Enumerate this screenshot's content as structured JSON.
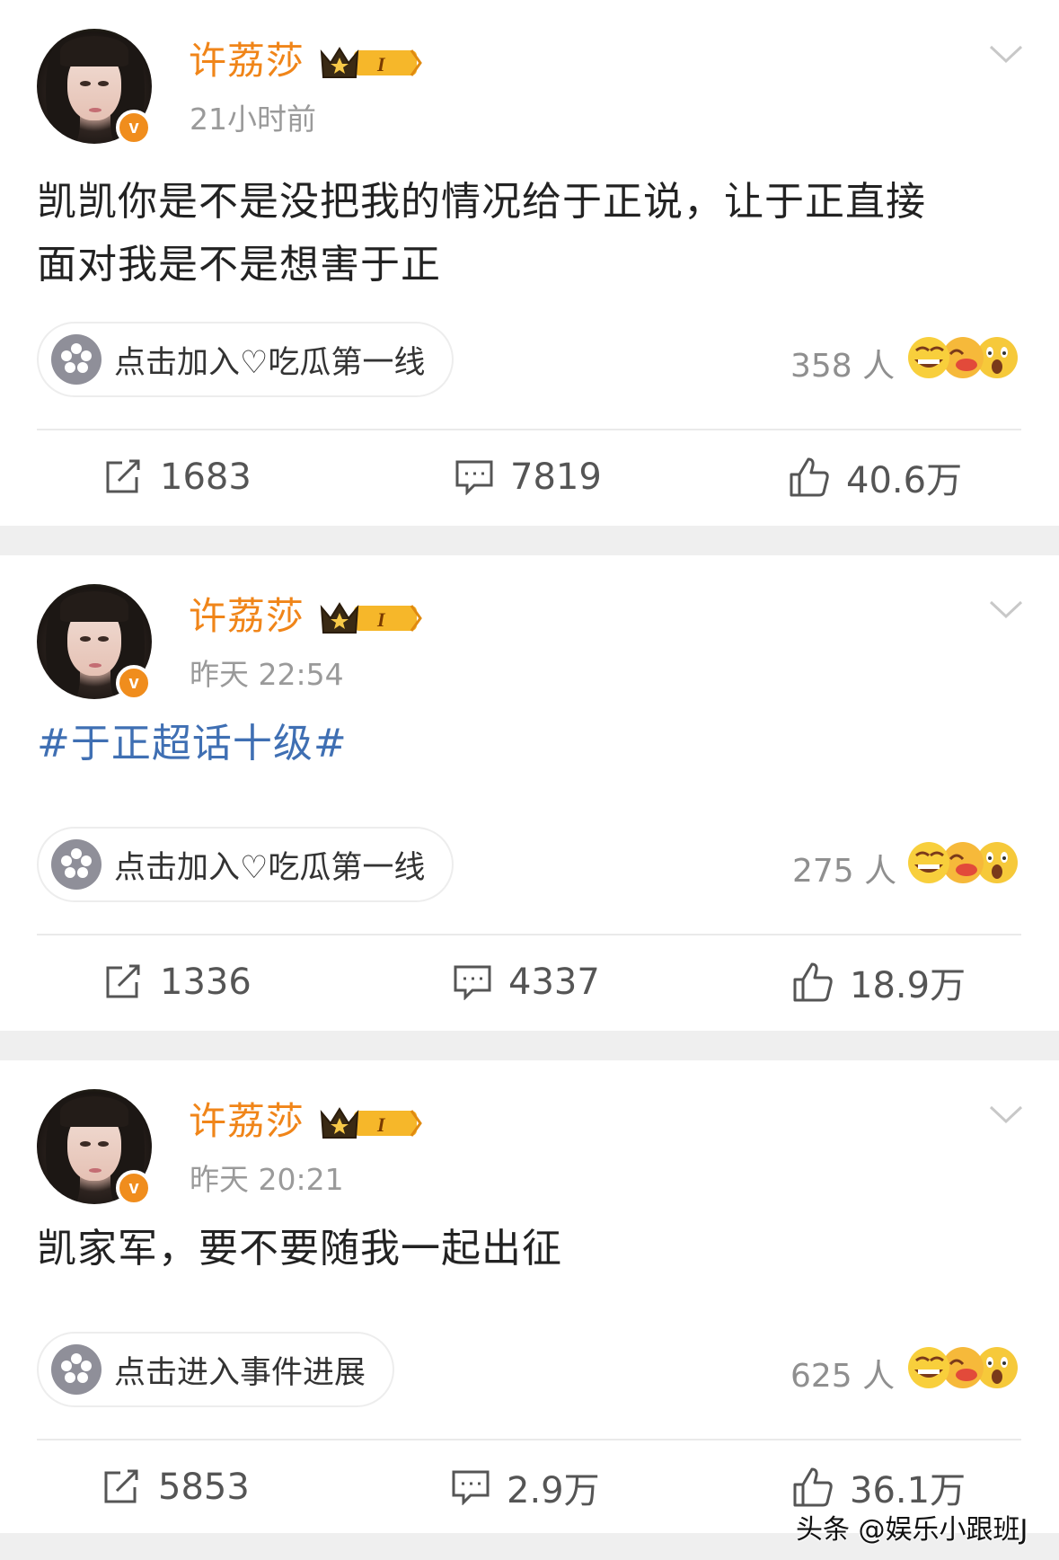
{
  "posts": [
    {
      "username": "许荔莎",
      "time": "21小时前",
      "text_lines": [
        "凯凯你是不是没把我的情况给于正说，让于正直接",
        "面对我是不是想害于正"
      ],
      "topic": false,
      "pill_label": "点击加入♡吃瓜第一线",
      "reaction_count": "358 人",
      "repost": "1683",
      "comment": "7819",
      "like": "40.6万"
    },
    {
      "username": "许荔莎",
      "time": "昨天 22:54",
      "text_lines": [
        "#于正超话十级#"
      ],
      "topic": true,
      "pill_label": "点击加入♡吃瓜第一线",
      "reaction_count": "275 人",
      "repost": "1336",
      "comment": "4337",
      "like": "18.9万"
    },
    {
      "username": "许荔莎",
      "time": "昨天 20:21",
      "text_lines": [
        "凯家军，要不要随我一起出征"
      ],
      "topic": false,
      "pill_label": "点击进入事件进展",
      "reaction_count": "625 人",
      "repost": "5853",
      "comment": "2.9万",
      "like": "36.1万"
    }
  ],
  "icons": {
    "repost": "repost-icon",
    "comment": "comment-icon",
    "like": "thumbs-up-icon",
    "menu": "chevron-down-icon",
    "verified": "verified-badge-icon",
    "vip": "crown-vip-icon",
    "pill": "flower-icon",
    "reactions": "emoji-reactions-icon"
  },
  "colors": {
    "username": "#f08519",
    "topic_link": "#3f6fb3",
    "verified": "#f08d1d",
    "separator": "#efefef"
  },
  "vip_level": "I",
  "watermark": "头条 @娱乐小跟班J"
}
